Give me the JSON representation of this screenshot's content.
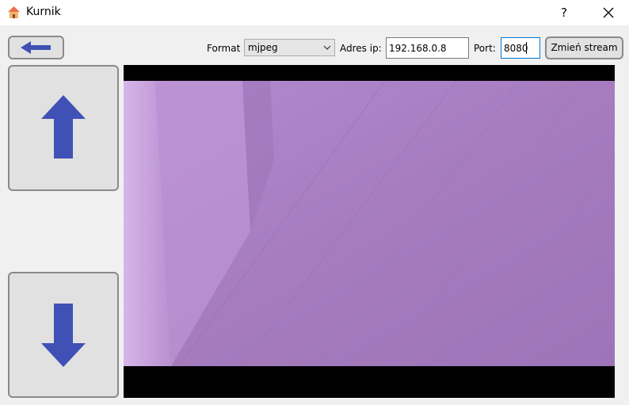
{
  "window": {
    "title": "Kurnik",
    "help_label": "?"
  },
  "toolbar": {
    "format_label": "Format",
    "format_value": "mjpeg",
    "ip_label": "Adres ip:",
    "ip_value": "192.168.0.8",
    "port_label": "Port:",
    "port_value": "8080",
    "change_stream_label": "Zmień stream"
  },
  "icons": {
    "app": "house-icon",
    "back": "arrow-left-icon",
    "up": "arrow-up-icon",
    "down": "arrow-down-icon",
    "dropdown": "chevron-down-icon",
    "close": "close-icon"
  },
  "colors": {
    "arrow": "#3f51b5",
    "stream_tint": "#a97fc4"
  }
}
